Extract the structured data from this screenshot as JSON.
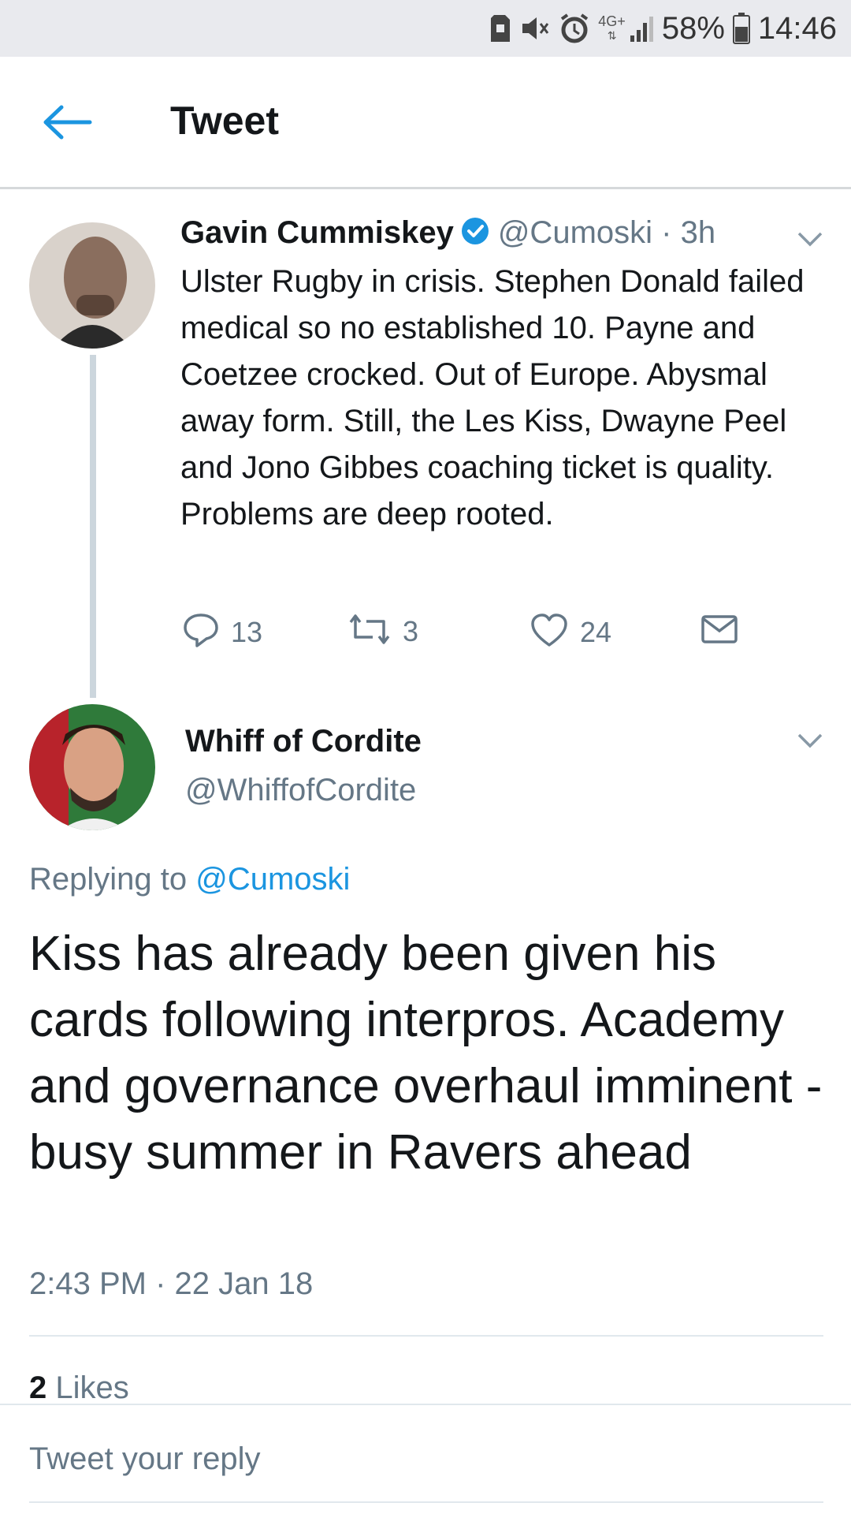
{
  "status_bar": {
    "network": "4G+",
    "battery_percent": "58%",
    "time": "14:46",
    "icons": [
      "sd-card-icon",
      "mute-icon",
      "alarm-icon",
      "signal-icon",
      "battery-icon"
    ]
  },
  "header": {
    "title": "Tweet",
    "back_icon": "back-arrow-icon"
  },
  "colors": {
    "accent": "#1b95e0",
    "text": "#14171a",
    "secondary_text": "#657786",
    "thread_line": "#ccd6dd",
    "status_bar_bg": "#e9eaee"
  },
  "original_tweet": {
    "name": "Gavin Cummiskey",
    "verified": true,
    "handle_time": "@Cumoski · 3h",
    "text": "Ulster Rugby in crisis. Stephen Donald failed medical so no established 10. Payne and Coetzee crocked. Out of Europe. Abysmal away form. Still, the Les Kiss, Dwayne Peel and Jono Gibbes coaching ticket is quality. Problems are deep rooted.",
    "reply_count": "13",
    "retweet_count": "3",
    "like_count": "24"
  },
  "reply_tweet": {
    "name": "Whiff of Cordite",
    "handle": "@WhiffofCordite",
    "replying_prefix": "Replying to",
    "replying_to": "@Cumoski",
    "text": "Kiss has already been given his cards following interpros. Academy and governance overhaul imminent - busy summer in Ravers ahead",
    "timestamp": "2:43 PM · 22 Jan 18",
    "likes_count": "2",
    "likes_label": "Likes"
  },
  "compose": {
    "placeholder": "Tweet your reply"
  }
}
